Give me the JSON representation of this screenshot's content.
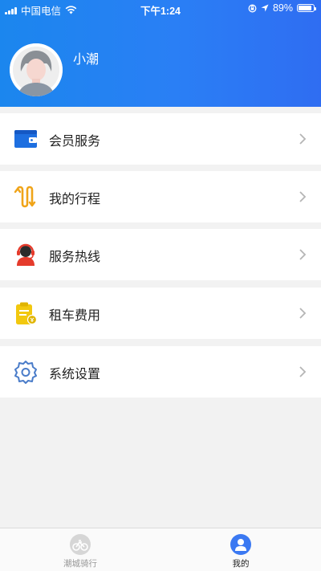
{
  "status_bar": {
    "carrier": "中国电信",
    "time": "下午1:24",
    "battery": "89%",
    "battery_level": 0.89
  },
  "profile": {
    "username": "小潮"
  },
  "menu": [
    {
      "label": "会员服务",
      "icon": "wallet-icon",
      "color": "#1e6fe0"
    },
    {
      "label": "我的行程",
      "icon": "route-icon",
      "color": "#f0a419"
    },
    {
      "label": "服务热线",
      "icon": "customer-service-icon",
      "color": "#e53b2c"
    },
    {
      "label": "租车费用",
      "icon": "bill-icon",
      "color": "#f2c80f"
    },
    {
      "label": "系统设置",
      "icon": "gear-icon",
      "color": "#4a7cc9"
    }
  ],
  "tabbar": {
    "tabs": [
      {
        "label": "潮城骑行",
        "icon": "bike-icon"
      },
      {
        "label": "我的",
        "icon": "profile-icon"
      }
    ]
  },
  "colors": {
    "header_start": "#1b86ee",
    "header_end": "#2f6df2",
    "background": "#f2f2f2"
  }
}
